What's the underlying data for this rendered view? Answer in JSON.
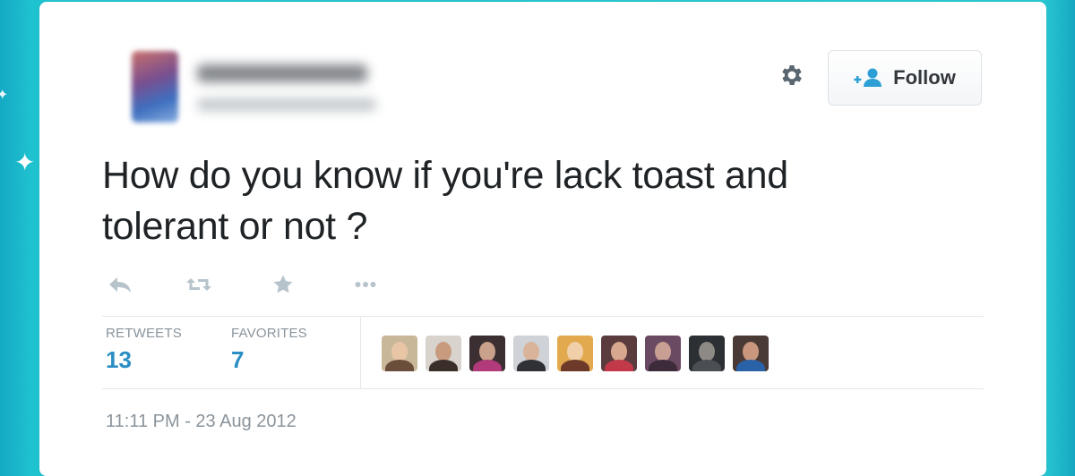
{
  "header": {
    "follow_label": "Follow",
    "settings_icon": "gear-icon",
    "follow_icon": "add-user-icon"
  },
  "tweet": {
    "text_line1": "How do you know if you're lack toast and",
    "text_line2": "tolerant or not ?"
  },
  "actions": [
    "reply-icon",
    "retweet-icon",
    "favorite-star-icon",
    "more-icon"
  ],
  "stats": {
    "retweets_label": "RETWEETS",
    "retweets_count": "13",
    "favorites_label": "FAVORITES",
    "favorites_count": "7"
  },
  "timestamp": "11:11 PM - 23 Aug 2012",
  "colors": {
    "background": "#22c2cf",
    "accent": "#2b8ec5",
    "muted": "#8a949c",
    "icon": "#b7c3cb"
  }
}
